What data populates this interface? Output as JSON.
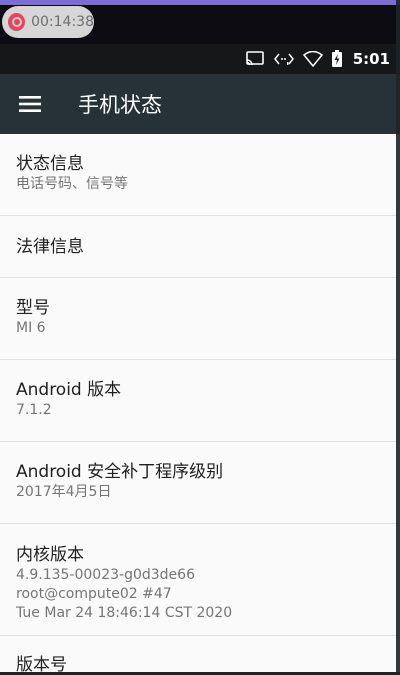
{
  "recorder": {
    "time": "00:14:38"
  },
  "status_bar": {
    "time": "5:01",
    "icons": [
      "cast-icon",
      "data-arrows-icon",
      "wifi-icon",
      "battery-icon"
    ]
  },
  "app_bar": {
    "title": "手机状态",
    "menu_icon": "hamburger-menu-icon"
  },
  "items": [
    {
      "title": "状态信息",
      "subtitle": "电话号码、信号等"
    },
    {
      "title": "法律信息"
    },
    {
      "title": "型号",
      "subtitle": "MI 6"
    },
    {
      "title": "Android 版本",
      "subtitle": "7.1.2"
    },
    {
      "title": "Android 安全补丁程序级别",
      "subtitle": "2017年4月5日"
    },
    {
      "title": "内核版本",
      "lines": [
        "4.9.135-00023-g0d3de66",
        "root@compute02 #47",
        "Tue Mar 24 18:46:14 CST 2020"
      ]
    },
    {
      "title": "版本号"
    }
  ],
  "colors": {
    "app_bar": "#263238",
    "status_bar": "#151718",
    "background": "#fafafa",
    "primary_text": "#212121",
    "secondary_text": "#757575",
    "recording_accent": "#7b6cd9"
  }
}
